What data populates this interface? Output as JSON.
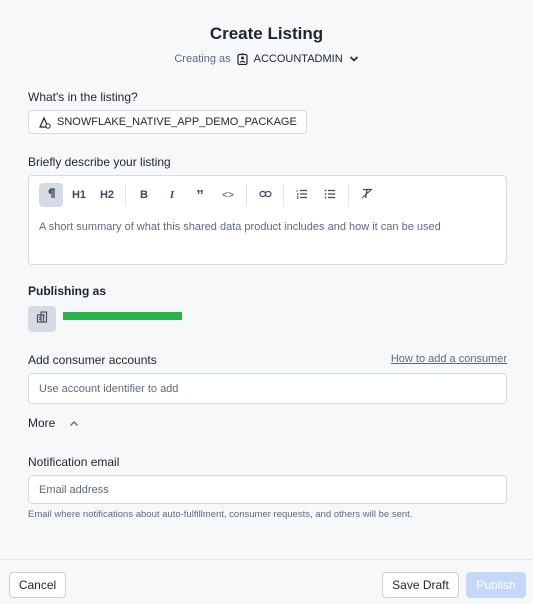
{
  "header": {
    "title": "Create Listing",
    "creating_as_label": "Creating as",
    "role": "ACCOUNTADMIN"
  },
  "listing": {
    "label": "What's in the listing?",
    "package_name": "SNOWFLAKE_NATIVE_APP_DEMO_PACKAGE"
  },
  "description": {
    "label": "Briefly describe your listing",
    "toolbar": {
      "h1": "H1",
      "h2": "H2",
      "bold": "B",
      "italic": "I",
      "quote": "”",
      "code": "<>"
    },
    "placeholder": "A short summary of what this shared data product includes and how it can be used"
  },
  "publishing": {
    "label": "Publishing as",
    "accent_color": "#29b34a"
  },
  "consumers": {
    "label": "Add consumer accounts",
    "help_link": "How to add a consumer",
    "placeholder": "Use account identifier to add"
  },
  "more": {
    "label": "More"
  },
  "notification": {
    "label": "Notification email",
    "placeholder": "Email address",
    "helper": "Email where notifications about auto-fulfillment, consumer requests, and others will be sent."
  },
  "footer": {
    "cancel": "Cancel",
    "save_draft": "Save Draft",
    "publish": "Publish"
  }
}
